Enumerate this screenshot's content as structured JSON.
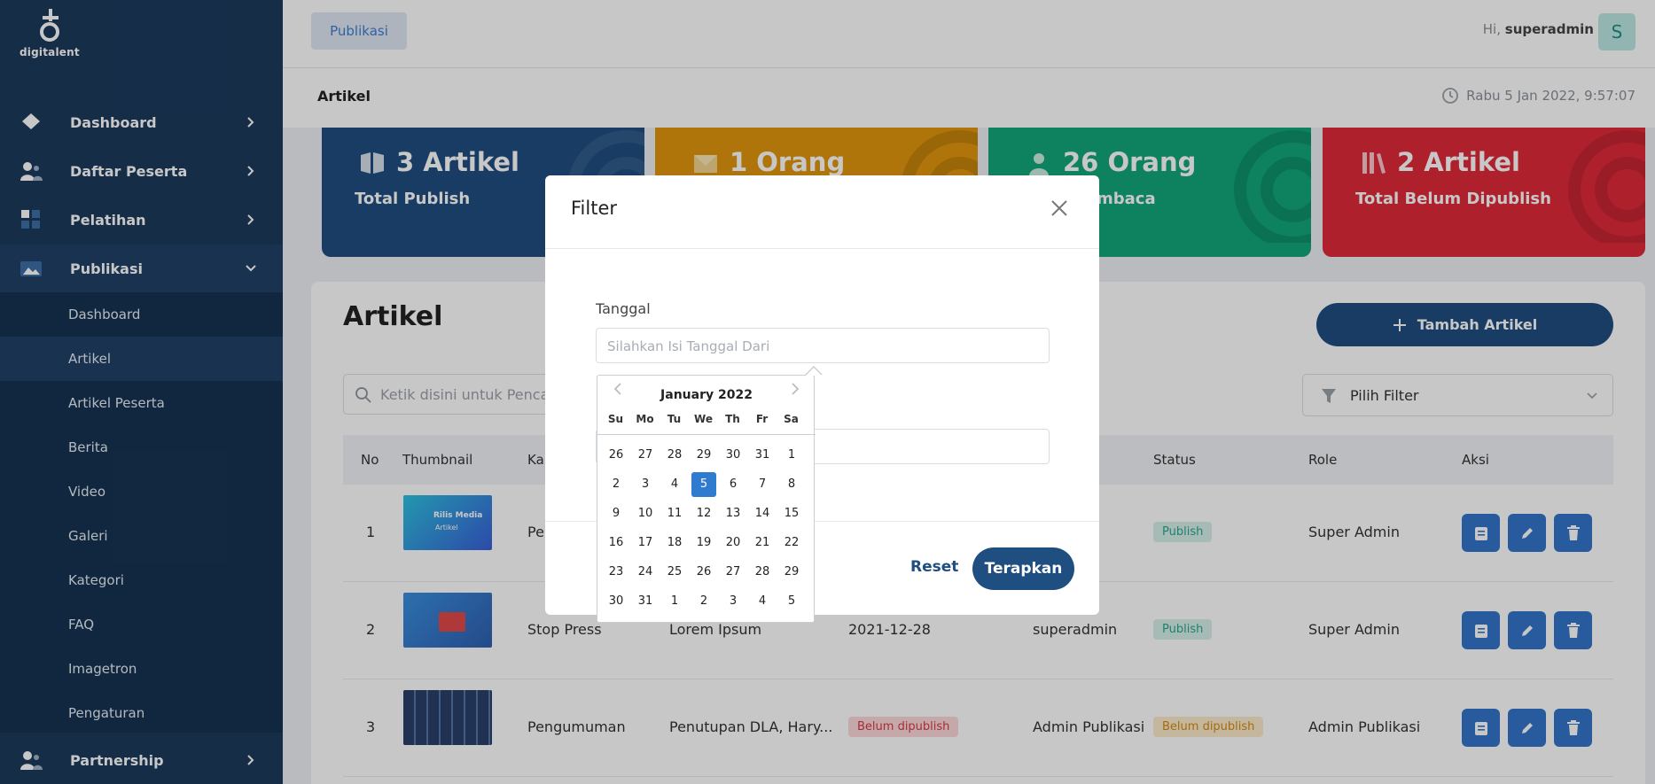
{
  "brand": {
    "logo_text": "digitalent"
  },
  "sidebar": {
    "items": [
      {
        "label": "Dashboard",
        "icon": "diamond-icon"
      },
      {
        "label": "Daftar Peserta",
        "icon": "users-icon"
      },
      {
        "label": "Pelatihan",
        "icon": "grid-icon"
      },
      {
        "label": "Publikasi",
        "icon": "image-folder-icon"
      }
    ],
    "sub_items": [
      "Dashboard",
      "Artikel",
      "Artikel Peserta",
      "Berita",
      "Video",
      "Galeri",
      "Kategori",
      "FAQ",
      "Imagetron",
      "Pengaturan"
    ],
    "partnership": "Partnership"
  },
  "topbar": {
    "pill": "Publikasi",
    "greeting": "Hi,",
    "username": "superadmin",
    "avatar": "S"
  },
  "subbar": {
    "title": "Artikel",
    "datetime": "Rabu 5 Jan 2022, 9:57:07"
  },
  "stats": [
    {
      "num": "3 Artikel",
      "label": "Total Publish",
      "color": "#1f4e80"
    },
    {
      "num": "1 Orang",
      "label": "",
      "color": "#e0970d"
    },
    {
      "num": "26 Orang",
      "label": "mbaca",
      "color": "#12a67a"
    },
    {
      "num": "2 Artikel",
      "label": "Total Belum Dipublish",
      "color": "#e02a3a"
    }
  ],
  "panel": {
    "title": "Artikel",
    "add_button": "Tambah Artikel",
    "search_placeholder": "Ketik disini untuk Pencarian",
    "filter_placeholder": "Pilih Filter"
  },
  "table": {
    "headers": {
      "no": "No",
      "thumb": "Thumbnail",
      "kat": "Ka",
      "status": "Status",
      "role": "Role",
      "aksi": "Aksi"
    },
    "rows": [
      {
        "no": "1",
        "kategori": "Pe",
        "judul": "",
        "tanggal": "",
        "author": "",
        "status": "Publish",
        "role": "Super Admin",
        "thumb_title": "Rilis Media",
        "thumb_sub": "Artikel"
      },
      {
        "no": "2",
        "kategori": "Stop Press",
        "judul": "Lorem Ipsum",
        "tanggal": "2021-12-28",
        "author": "superadmin",
        "status": "Publish",
        "role": "Super Admin"
      },
      {
        "no": "3",
        "kategori": "Pengumuman",
        "judul": "Penutupan DLA, Hary...",
        "tanggal": "Belum dipublish",
        "author": "Admin Publikasi",
        "status": "Belum dipublish",
        "role": "Admin Publikasi"
      }
    ]
  },
  "modal": {
    "title": "Filter",
    "field_label": "Tanggal",
    "field_placeholder": "Silahkan Isi Tanggal Dari",
    "reset": "Reset",
    "apply": "Terapkan"
  },
  "datepicker": {
    "month": "January 2022",
    "dow": [
      "Su",
      "Mo",
      "Tu",
      "We",
      "Th",
      "Fr",
      "Sa"
    ],
    "weeks": [
      [
        "26",
        "27",
        "28",
        "29",
        "30",
        "31",
        "1"
      ],
      [
        "2",
        "3",
        "4",
        "5",
        "6",
        "7",
        "8"
      ],
      [
        "9",
        "10",
        "11",
        "12",
        "13",
        "14",
        "15"
      ],
      [
        "16",
        "17",
        "18",
        "19",
        "20",
        "21",
        "22"
      ],
      [
        "23",
        "24",
        "25",
        "26",
        "27",
        "28",
        "29"
      ],
      [
        "30",
        "31",
        "1",
        "2",
        "3",
        "4",
        "5"
      ]
    ],
    "selected": "5"
  }
}
